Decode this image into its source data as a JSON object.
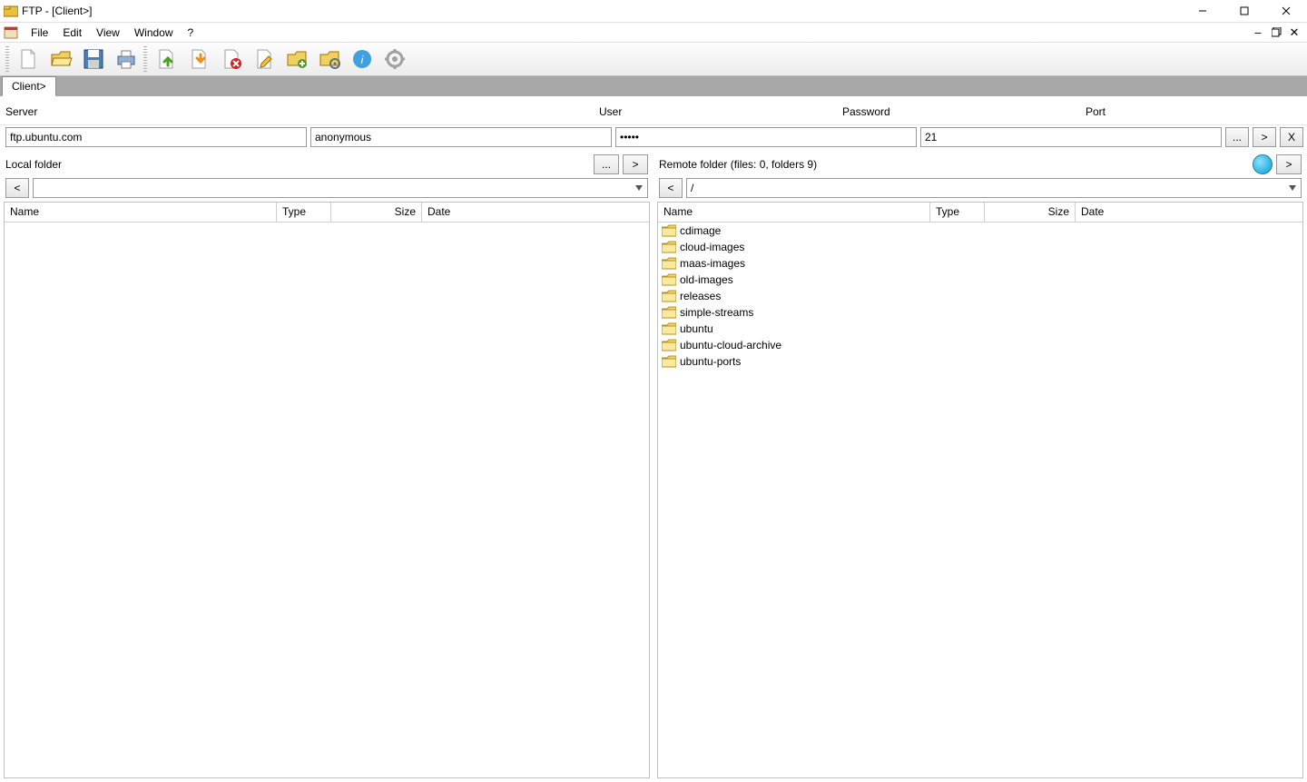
{
  "window": {
    "title": "FTP - [Client>]"
  },
  "menu": {
    "items": [
      "File",
      "Edit",
      "View",
      "Window",
      "?"
    ]
  },
  "tab": {
    "label": "Client>"
  },
  "connection": {
    "server_label": "Server",
    "server_value": "ftp.ubuntu.com",
    "user_label": "User",
    "user_value": "anonymous",
    "password_label": "Password",
    "password_value": "•••••",
    "port_label": "Port",
    "port_value": "21",
    "browse_btn": "...",
    "connect_btn": ">",
    "disconnect_btn": "X"
  },
  "folders": {
    "local_label": "Local folder",
    "local_browse": "...",
    "local_go": ">",
    "local_back": "<",
    "local_path": "",
    "remote_label": "Remote folder (files: 0, folders 9)",
    "remote_go": ">",
    "remote_back": "<",
    "remote_path": "/"
  },
  "columns": {
    "name": "Name",
    "type": "Type",
    "size": "Size",
    "date": "Date"
  },
  "local_files": [],
  "remote_files": [
    {
      "name": "cdimage"
    },
    {
      "name": "cloud-images"
    },
    {
      "name": "maas-images"
    },
    {
      "name": "old-images"
    },
    {
      "name": "releases"
    },
    {
      "name": "simple-streams"
    },
    {
      "name": "ubuntu"
    },
    {
      "name": "ubuntu-cloud-archive"
    },
    {
      "name": "ubuntu-ports"
    }
  ]
}
